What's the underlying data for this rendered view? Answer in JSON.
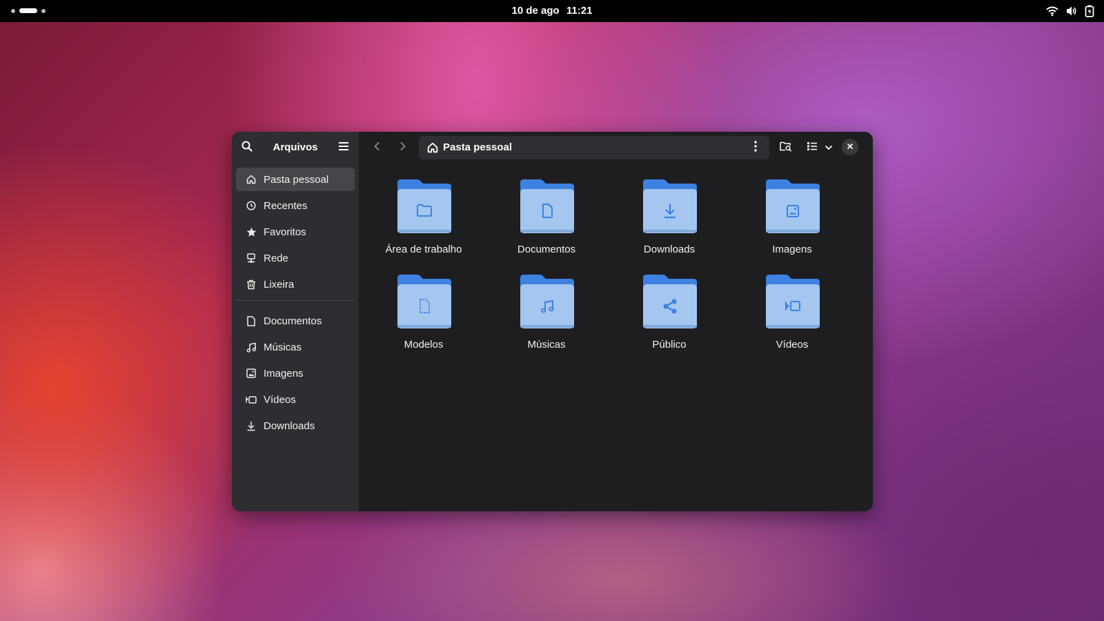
{
  "topbar": {
    "date": "10 de ago",
    "time": "11:21"
  },
  "sidebar": {
    "title": "Arquivos",
    "places": [
      {
        "label": "Pasta pessoal",
        "icon": "home-icon",
        "active": true
      },
      {
        "label": "Recentes",
        "icon": "clock-icon"
      },
      {
        "label": "Favoritos",
        "icon": "star-icon"
      },
      {
        "label": "Rede",
        "icon": "network-icon"
      },
      {
        "label": "Lixeira",
        "icon": "trash-icon"
      }
    ],
    "bookmarks": [
      {
        "label": "Documentos",
        "icon": "document-icon"
      },
      {
        "label": "Músicas",
        "icon": "music-icon"
      },
      {
        "label": "Imagens",
        "icon": "image-icon"
      },
      {
        "label": "Vídeos",
        "icon": "video-icon"
      },
      {
        "label": "Downloads",
        "icon": "download-icon"
      }
    ]
  },
  "header": {
    "path": "Pasta pessoal"
  },
  "folders": [
    {
      "label": "Área de trabalho",
      "icon": "folder-icon"
    },
    {
      "label": "Documentos",
      "icon": "document-icon"
    },
    {
      "label": "Downloads",
      "icon": "download-icon"
    },
    {
      "label": "Imagens",
      "icon": "image-icon"
    },
    {
      "label": "Modelos",
      "icon": "template-icon"
    },
    {
      "label": "Músicas",
      "icon": "music-icon"
    },
    {
      "label": "Público",
      "icon": "share-icon"
    },
    {
      "label": "Vídeos",
      "icon": "video-icon"
    }
  ],
  "colors": {
    "folder_back": "#3d82e0",
    "folder_front": "#a4c6ef",
    "folder_glyph": "#3d82e0",
    "sidebar_bg": "#2e2e32",
    "main_bg": "#1e1e20"
  }
}
